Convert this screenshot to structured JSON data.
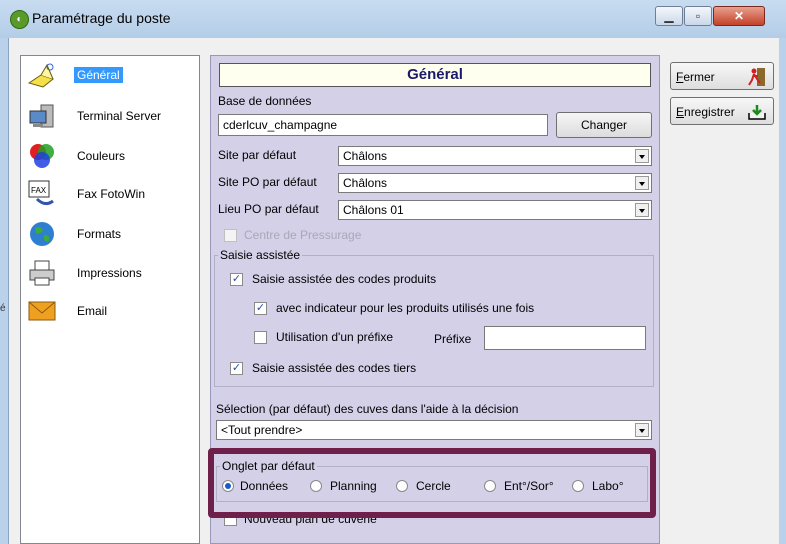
{
  "window": {
    "title": "Paramétrage du poste"
  },
  "nav": [
    {
      "label": "Général",
      "icon": "general-icon",
      "selected": true
    },
    {
      "label": "Terminal Server",
      "icon": "terminal-server-icon"
    },
    {
      "label": "Couleurs",
      "icon": "colors-icon"
    },
    {
      "label": "Fax FotoWin",
      "icon": "fax-icon",
      "icon_text": "FAX"
    },
    {
      "label": "Formats",
      "icon": "globe-icon"
    },
    {
      "label": "Impressions",
      "icon": "printer-icon"
    },
    {
      "label": "Email",
      "icon": "envelope-icon"
    }
  ],
  "main": {
    "header": "Général",
    "database_label": "Base de données",
    "database_value": "cderlcuv_champagne",
    "change_button": "Changer",
    "site_label": "Site par défaut",
    "site_value": "Châlons",
    "site_po_label": "Site PO par défaut",
    "site_po_value": "Châlons",
    "lieu_po_label": "Lieu PO par défaut",
    "lieu_po_value": "Châlons 01",
    "centre_label": "Centre de Pressurage",
    "assisted": {
      "legend": "Saisie assistée",
      "codes_produits": "Saisie assistée des codes produits",
      "indicateur": "avec indicateur pour les produits utilisés une fois",
      "prefixe": "Utilisation d'un préfixe",
      "prefixe_label": "Préfixe",
      "prefixe_value": "",
      "codes_tiers": "Saisie assistée des codes tiers"
    },
    "selection_label": "Sélection (par défaut) des cuves dans l'aide à la décision",
    "selection_value": "<Tout prendre>",
    "onglet": {
      "legend": "Onglet par défaut",
      "options": [
        "Données",
        "Planning",
        "Cercle",
        "Ent°/Sor°",
        "Labo°"
      ],
      "selected": "Données"
    },
    "nouveau_plan": "Nouveau plan de cuverie"
  },
  "buttons": {
    "fermer": "Fermer",
    "enregistrer": "Enregistrer"
  },
  "colors": {
    "highlight": "#6e1f4a",
    "selection": "#3399ff",
    "panel": "#d4d0e8"
  },
  "stray_char": "é"
}
